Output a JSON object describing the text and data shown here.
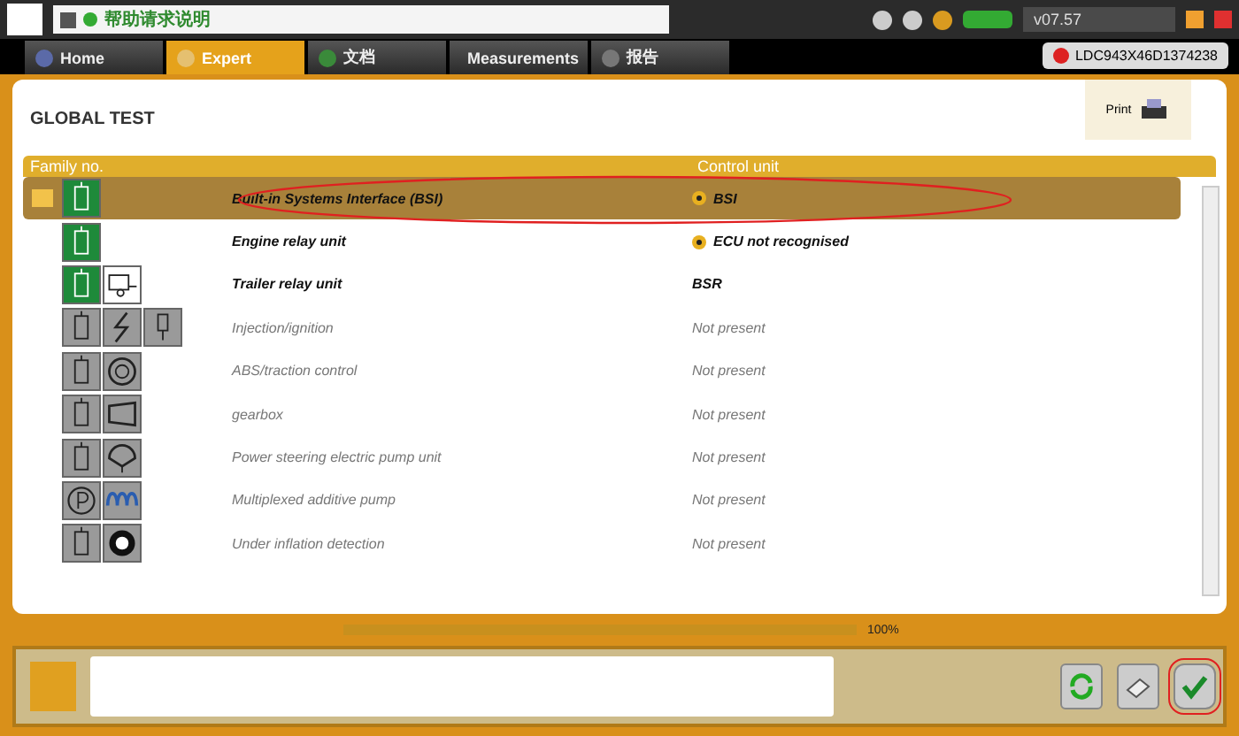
{
  "top_bar": {
    "help_text": "帮助请求说明",
    "version": "v07.57"
  },
  "tabs": [
    {
      "label": "Home",
      "selected": false
    },
    {
      "label": "Expert",
      "selected": true
    },
    {
      "label": "文档",
      "selected": false
    },
    {
      "label": "Measurements",
      "selected": false
    },
    {
      "label": "报告",
      "selected": false
    }
  ],
  "vin": "LDC943X46D1374238",
  "panel": {
    "title": "GLOBAL TEST",
    "print_label": "Print"
  },
  "table": {
    "columns": [
      "Family no.",
      "Control unit"
    ],
    "rows": [
      {
        "icons": [
          {
            "kind": "ecu"
          }
        ],
        "present": true,
        "selected": true,
        "flag": true,
        "name": "Built-in Systems Interface (BSI)",
        "unit": "BSI",
        "unit_icon": true
      },
      {
        "icons": [
          {
            "kind": "ecu"
          }
        ],
        "present": true,
        "selected": false,
        "flag": false,
        "name": "Engine relay unit",
        "unit": "ECU not recognised",
        "unit_icon": true
      },
      {
        "icons": [
          {
            "kind": "ecu"
          },
          {
            "kind": "trailer"
          }
        ],
        "present": true,
        "selected": false,
        "flag": false,
        "name": "Trailer relay unit",
        "unit": "BSR",
        "unit_icon": false
      },
      {
        "icons": [
          {
            "kind": "ecu"
          },
          {
            "kind": "spark"
          },
          {
            "kind": "injector"
          }
        ],
        "present": false,
        "selected": false,
        "flag": false,
        "name": "Injection/ignition",
        "unit": "Not present",
        "unit_icon": false
      },
      {
        "icons": [
          {
            "kind": "ecu"
          },
          {
            "kind": "abs"
          }
        ],
        "present": false,
        "selected": false,
        "flag": false,
        "name": "ABS/traction control",
        "unit": "Not present",
        "unit_icon": false
      },
      {
        "icons": [
          {
            "kind": "ecu"
          },
          {
            "kind": "gearbox"
          }
        ],
        "present": false,
        "selected": false,
        "flag": false,
        "name": "gearbox",
        "unit": "Not present",
        "unit_icon": false
      },
      {
        "icons": [
          {
            "kind": "ecu"
          },
          {
            "kind": "steering"
          }
        ],
        "present": false,
        "selected": false,
        "flag": false,
        "name": "Power steering electric pump unit",
        "unit": "Not present",
        "unit_icon": false
      },
      {
        "icons": [
          {
            "kind": "parking"
          },
          {
            "kind": "coil"
          }
        ],
        "present": false,
        "selected": false,
        "flag": false,
        "name": "Multiplexed additive pump",
        "unit": "Not present",
        "unit_icon": false
      },
      {
        "icons": [
          {
            "kind": "ecu"
          },
          {
            "kind": "tyre"
          }
        ],
        "present": false,
        "selected": false,
        "flag": false,
        "name": "Under inflation detection",
        "unit": "Not present",
        "unit_icon": false
      }
    ]
  },
  "progress": {
    "level": 1,
    "reading": "100%"
  }
}
